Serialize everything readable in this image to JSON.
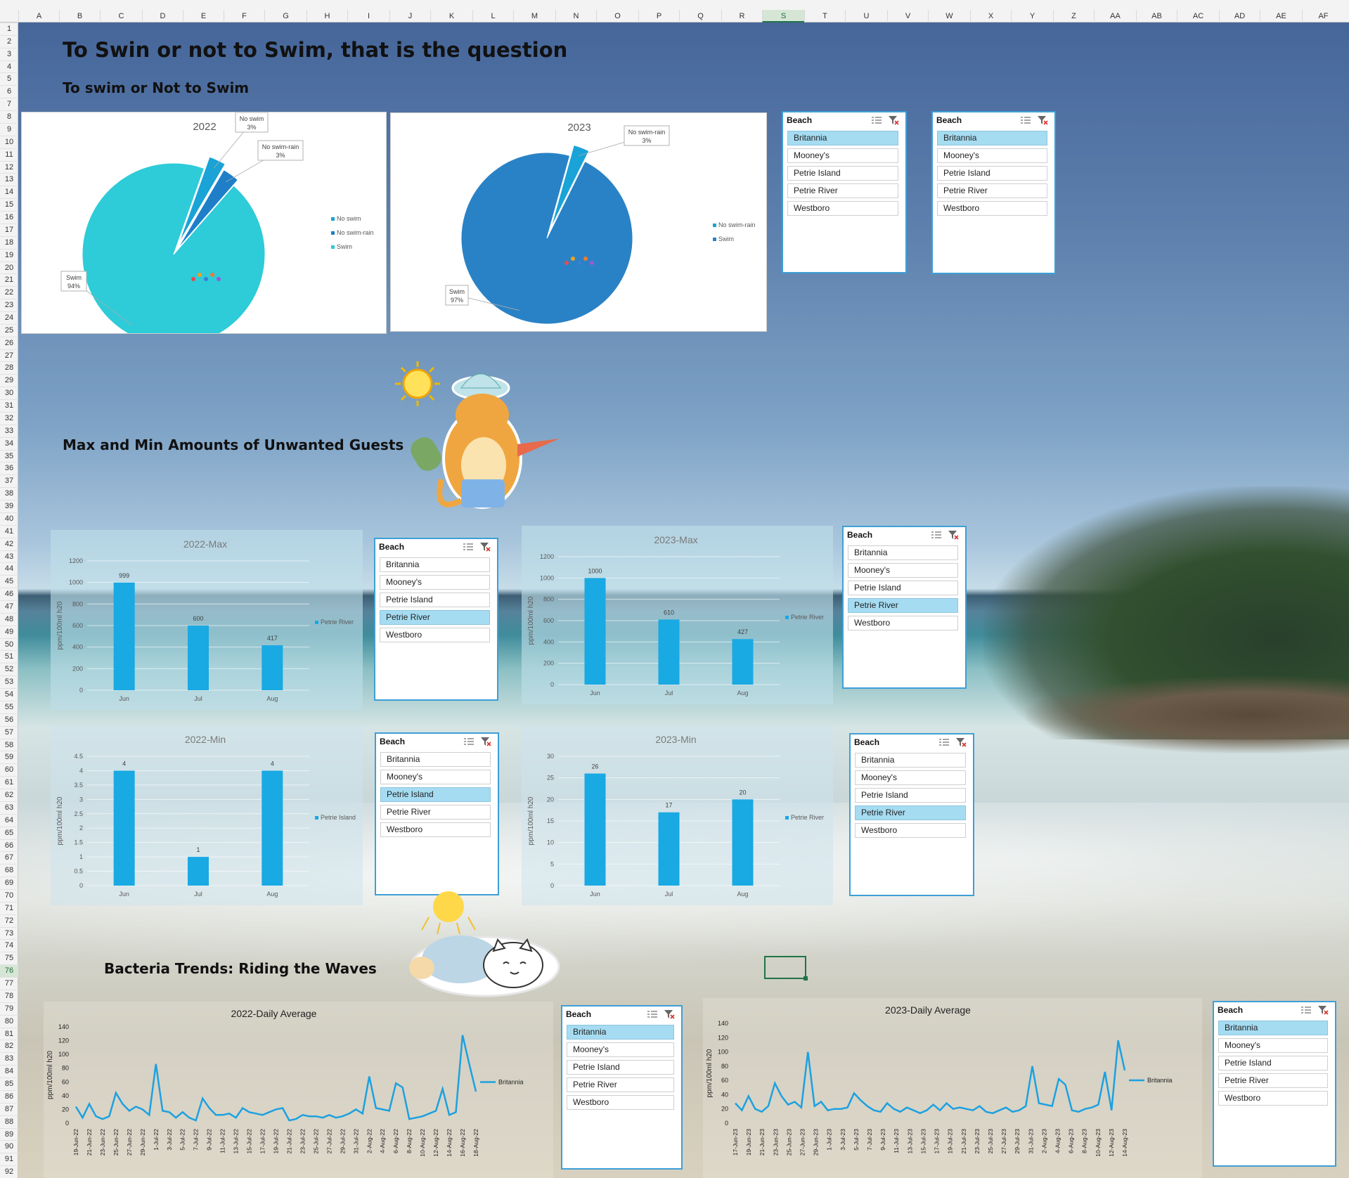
{
  "columns": [
    "A",
    "B",
    "C",
    "D",
    "E",
    "F",
    "G",
    "H",
    "I",
    "J",
    "K",
    "L",
    "M",
    "N",
    "O",
    "P",
    "Q",
    "R",
    "S",
    "T",
    "U",
    "V",
    "W",
    "X",
    "Y",
    "Z",
    "AA",
    "AB",
    "AC",
    "AD",
    "AE",
    "AF"
  ],
  "selected_column": "S",
  "selected_row": "76",
  "rows": [
    "1",
    "2",
    "3",
    "4",
    "5",
    "6",
    "7",
    "8",
    "9",
    "10",
    "11",
    "12",
    "13",
    "14",
    "15",
    "16",
    "17",
    "18",
    "19",
    "20",
    "21",
    "22",
    "23",
    "24",
    "25",
    "26",
    "27",
    "28",
    "29",
    "30",
    "31",
    "32",
    "33",
    "34",
    "35",
    "36",
    "37",
    "38",
    "39",
    "40",
    "41",
    "42",
    "43",
    "44",
    "45",
    "46",
    "47",
    "48",
    "49",
    "50",
    "51",
    "52",
    "53",
    "54",
    "55",
    "56",
    "57",
    "58",
    "59",
    "60",
    "61",
    "62",
    "63",
    "64",
    "65",
    "66",
    "67",
    "68",
    "69",
    "70",
    "71",
    "72",
    "73",
    "74",
    "75",
    "76",
    "77",
    "78",
    "79",
    "80",
    "81",
    "82",
    "83",
    "84",
    "85",
    "86",
    "87",
    "88",
    "89",
    "90",
    "91",
    "92"
  ],
  "headings": {
    "main_title": "To Swin or not to Swim, that is the question",
    "sub_title": "To swim or Not to Swim",
    "max_min": "Max and Min Amounts of Unwanted Guests",
    "trends": "Bacteria Trends: Riding the Waves"
  },
  "slicers": [
    {
      "id": "s1",
      "header": "Beach",
      "items": [
        "Britannia",
        "Mooney's",
        "Petrie Island",
        "Petrie River",
        "Westboro"
      ],
      "selected": "Britannia"
    },
    {
      "id": "s2",
      "header": "Beach",
      "items": [
        "Britannia",
        "Mooney's",
        "Petrie Island",
        "Petrie River",
        "Westboro"
      ],
      "selected": "Britannia"
    },
    {
      "id": "s3",
      "header": "Beach",
      "items": [
        "Britannia",
        "Mooney's",
        "Petrie Island",
        "Petrie River",
        "Westboro"
      ],
      "selected": "Petrie River"
    },
    {
      "id": "s4",
      "header": "Beach",
      "items": [
        "Britannia",
        "Mooney's",
        "Petrie Island",
        "Petrie River",
        "Westboro"
      ],
      "selected": "Petrie River"
    },
    {
      "id": "s5",
      "header": "Beach",
      "items": [
        "Britannia",
        "Mooney's",
        "Petrie Island",
        "Petrie River",
        "Westboro"
      ],
      "selected": "Petrie Island"
    },
    {
      "id": "s6",
      "header": "Beach",
      "items": [
        "Britannia",
        "Mooney's",
        "Petrie Island",
        "Petrie River",
        "Westboro"
      ],
      "selected": "Petrie River"
    },
    {
      "id": "s7",
      "header": "Beach",
      "items": [
        "Britannia",
        "Mooney's",
        "Petrie Island",
        "Petrie River",
        "Westboro"
      ],
      "selected": "Britannia"
    },
    {
      "id": "s8",
      "header": "Beach",
      "items": [
        "Britannia",
        "Mooney's",
        "Petrie Island",
        "Petrie River",
        "Westboro"
      ],
      "selected": "Britannia"
    }
  ],
  "icons": {
    "multiselect": "multi-select-icon",
    "clear_filter": "clear-filter-icon",
    "sun": "sun-icon",
    "cat_beach": "beach-cat-sticker",
    "cat_sleep": "sleeping-cat-sticker"
  },
  "colors": {
    "pie_swim_2022": "#2ecbd8",
    "pie_noswim": "#1aa3d6",
    "pie_noswimrain": "#1e7fc8",
    "pie_swim_2023": "#2a82c6",
    "bar": "#19a9e3",
    "line": "#1ca1e0",
    "slicer_border": "#3e9fd6",
    "slicer_selected": "#a6dcf2"
  },
  "chart_data": [
    {
      "id": "pie2022",
      "type": "pie",
      "title": "2022",
      "slices": [
        {
          "label": "No swim",
          "value": 3
        },
        {
          "label": "No swim-rain",
          "value": 3
        },
        {
          "label": "Swim",
          "value": 94
        }
      ],
      "data_labels": [
        {
          "name": "No swim",
          "pct": "3%"
        },
        {
          "name": "No swim-rain",
          "pct": "3%"
        },
        {
          "name": "Swim",
          "pct": "94%"
        }
      ],
      "legend": [
        "No swim",
        "No swim-rain",
        "Swim"
      ],
      "legend_position": "right"
    },
    {
      "id": "pie2023",
      "type": "pie",
      "title": "2023",
      "slices": [
        {
          "label": "No swim-rain",
          "value": 3
        },
        {
          "label": "Swim",
          "value": 97
        }
      ],
      "data_labels": [
        {
          "name": "No swim-rain",
          "pct": "3%"
        },
        {
          "name": "Swim",
          "pct": "97%"
        }
      ],
      "legend": [
        "No swim-rain",
        "Swim"
      ],
      "legend_position": "right"
    },
    {
      "id": "max2022",
      "type": "bar",
      "title": "2022-Max",
      "categories": [
        "Jun",
        "Jul",
        "Aug"
      ],
      "values": [
        999,
        600,
        417
      ],
      "ylabel": "ppm/100ml h20",
      "ylim": [
        0,
        1200
      ],
      "yticks": [
        "0",
        "200",
        "400",
        "600",
        "800",
        "1000",
        "1200"
      ],
      "series_name": "Petrie River",
      "legend_position": "right"
    },
    {
      "id": "max2023",
      "type": "bar",
      "title": "2023-Max",
      "categories": [
        "Jun",
        "Jul",
        "Aug"
      ],
      "values": [
        1000,
        610,
        427
      ],
      "ylabel": "ppm/100ml h20",
      "ylim": [
        0,
        1200
      ],
      "yticks": [
        "0",
        "200",
        "400",
        "600",
        "800",
        "1000",
        "1200"
      ],
      "series_name": "Petrie River",
      "legend_position": "right"
    },
    {
      "id": "min2022",
      "type": "bar",
      "title": "2022-Min",
      "categories": [
        "Jun",
        "Jul",
        "Aug"
      ],
      "values": [
        4,
        1,
        4
      ],
      "ylabel": "ppm/100ml h20",
      "ylim": [
        0,
        4.5
      ],
      "yticks": [
        "0",
        "0.5",
        "1",
        "1.5",
        "2",
        "2.5",
        "3",
        "3.5",
        "4",
        "4.5"
      ],
      "series_name": "Petrie Island",
      "legend_position": "right"
    },
    {
      "id": "min2023",
      "type": "bar",
      "title": "2023-Min",
      "categories": [
        "Jun",
        "Jul",
        "Aug"
      ],
      "values": [
        26,
        17,
        20
      ],
      "ylabel": "ppm/100ml h20",
      "ylim": [
        0,
        30
      ],
      "yticks": [
        "0",
        "5",
        "10",
        "15",
        "20",
        "25",
        "30"
      ],
      "series_name": "Petrie River",
      "legend_position": "right"
    },
    {
      "id": "daily2022",
      "type": "line",
      "title": "2022-Daily Average",
      "ylabel": "ppm/100ml h20",
      "ylim": [
        0,
        140
      ],
      "yticks": [
        "0",
        "20",
        "40",
        "60",
        "80",
        "100",
        "120",
        "140"
      ],
      "series_name": "Britannia",
      "legend_position": "right",
      "xticks": [
        "19-Jun-22",
        "21-Jun-22",
        "23-Jun-22",
        "25-Jun-22",
        "27-Jun-22",
        "29-Jun-22",
        "1-Jul-22",
        "3-Jul-22",
        "5-Jul-22",
        "7-Jul-22",
        "9-Jul-22",
        "11-Jul-22",
        "13-Jul-22",
        "15-Jul-22",
        "17-Jul-22",
        "19-Jul-22",
        "21-Jul-22",
        "23-Jul-22",
        "25-Jul-22",
        "27-Jul-22",
        "29-Jul-22",
        "31-Jul-22",
        "2-Aug-22",
        "4-Aug-22",
        "6-Aug-22",
        "8-Aug-22",
        "10-Aug-22",
        "12-Aug-22",
        "14-Aug-22",
        "16-Aug-22",
        "18-Aug-22"
      ],
      "values": [
        24,
        8,
        28,
        10,
        6,
        10,
        44,
        28,
        18,
        24,
        20,
        12,
        86,
        18,
        16,
        8,
        16,
        8,
        4,
        36,
        22,
        12,
        12,
        14,
        8,
        22,
        16,
        14,
        12,
        16,
        20,
        22,
        4,
        6,
        12,
        10,
        10,
        8,
        12,
        8,
        10,
        14,
        20,
        14,
        68,
        22,
        20,
        18,
        58,
        52,
        6,
        8,
        10,
        14,
        18,
        50,
        12,
        16,
        128,
        86,
        46
      ]
    },
    {
      "id": "daily2023",
      "type": "line",
      "title": "2023-Daily Average",
      "ylabel": "ppm/100ml h20",
      "ylim": [
        0,
        140
      ],
      "yticks": [
        "0",
        "20",
        "40",
        "60",
        "80",
        "100",
        "120",
        "140"
      ],
      "series_name": "Britannia",
      "legend_position": "right",
      "xticks": [
        "17-Jun-23",
        "19-Jun-23",
        "21-Jun-23",
        "23-Jun-23",
        "25-Jun-23",
        "27-Jun-23",
        "29-Jun-23",
        "1-Jul-23",
        "3-Jul-23",
        "5-Jul-23",
        "7-Jul-23",
        "9-Jul-23",
        "11-Jul-23",
        "13-Jul-23",
        "15-Jul-23",
        "17-Jul-23",
        "19-Jul-23",
        "21-Jul-23",
        "23-Jul-23",
        "25-Jul-23",
        "27-Jul-23",
        "29-Jul-23",
        "31-Jul-23",
        "2-Aug-23",
        "4-Aug-23",
        "6-Aug-23",
        "8-Aug-23",
        "10-Aug-23",
        "12-Aug-23",
        "14-Aug-23"
      ],
      "values": [
        28,
        18,
        38,
        20,
        16,
        24,
        56,
        38,
        26,
        30,
        22,
        100,
        24,
        30,
        18,
        20,
        20,
        22,
        42,
        32,
        24,
        18,
        16,
        28,
        20,
        16,
        22,
        18,
        14,
        18,
        26,
        18,
        28,
        20,
        22,
        20,
        18,
        24,
        16,
        14,
        18,
        22,
        16,
        18,
        24,
        80,
        28,
        26,
        24,
        62,
        54,
        18,
        16,
        20,
        22,
        26,
        72,
        18,
        116,
        74
      ]
    }
  ]
}
